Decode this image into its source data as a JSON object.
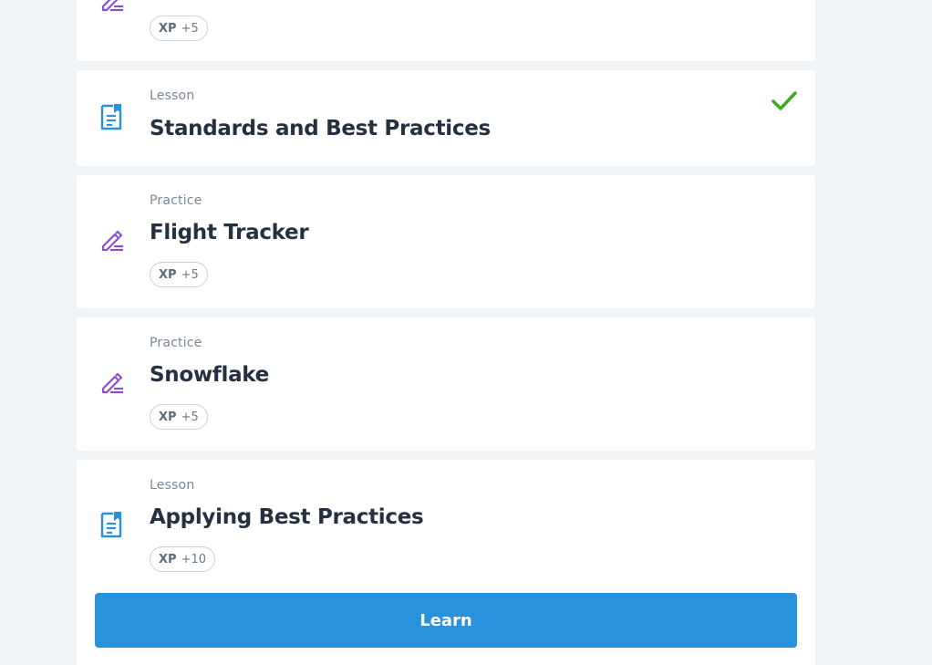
{
  "colors": {
    "page_background": "#f1f4f7",
    "card_background": "#ffffff",
    "lesson_icon": "#2a91dc",
    "practice_icon": "#8a4fd1",
    "complete_check": "#3eab24",
    "learn_button": "#2a91dc"
  },
  "cards": [
    {
      "kind": "practice",
      "icon": "pencil-icon",
      "xp_label": "XP",
      "xp_value": "+5"
    },
    {
      "kind": "lesson",
      "icon": "lesson-document-icon",
      "type": "Lesson",
      "title": "Standards and Best Practices",
      "completed": true,
      "status_icon": "checkmark-icon"
    },
    {
      "kind": "practice",
      "icon": "pencil-icon",
      "type": "Practice",
      "title": "Flight Tracker",
      "xp_label": "XP",
      "xp_value": "+5"
    },
    {
      "kind": "practice",
      "icon": "pencil-icon",
      "type": "Practice",
      "title": "Snowflake",
      "xp_label": "XP",
      "xp_value": "+5"
    },
    {
      "kind": "lesson",
      "icon": "lesson-document-icon",
      "type": "Lesson",
      "title": "Applying Best Practices",
      "xp_label": "XP",
      "xp_value": "+10",
      "action_label": "Learn"
    }
  ]
}
